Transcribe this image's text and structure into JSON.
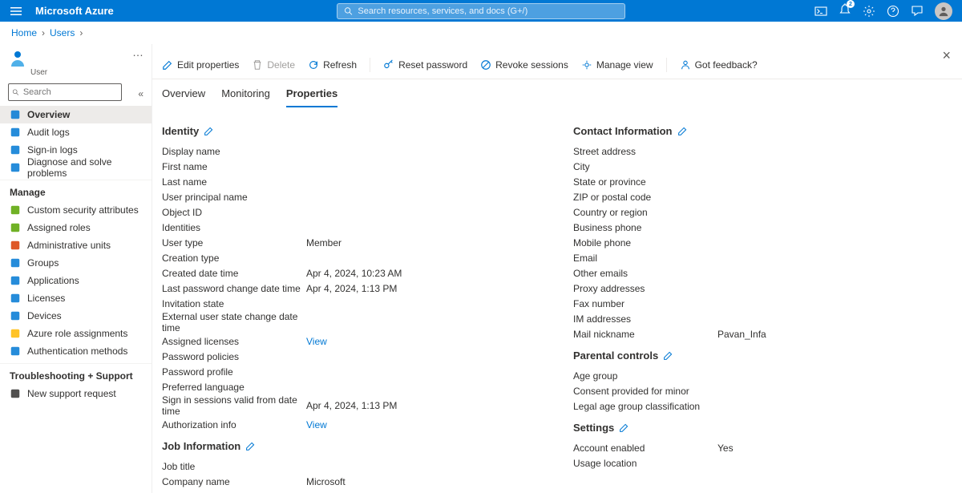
{
  "brand": "Microsoft Azure",
  "search_placeholder": "Search resources, services, and docs (G+/)",
  "notification_count": "2",
  "breadcrumb": {
    "home": "Home",
    "users": "Users"
  },
  "user_sub": "User",
  "local_search_placeholder": "Search",
  "sidebar": {
    "main": [
      {
        "label": "Overview",
        "icon": "preview"
      },
      {
        "label": "Audit logs",
        "icon": "log"
      },
      {
        "label": "Sign-in logs",
        "icon": "signin"
      },
      {
        "label": "Diagnose and solve problems",
        "icon": "diagnose"
      }
    ],
    "manage_header": "Manage",
    "manage": [
      {
        "label": "Custom security attributes",
        "icon": "sec"
      },
      {
        "label": "Assigned roles",
        "icon": "roles"
      },
      {
        "label": "Administrative units",
        "icon": "admin"
      },
      {
        "label": "Groups",
        "icon": "groups"
      },
      {
        "label": "Applications",
        "icon": "apps"
      },
      {
        "label": "Licenses",
        "icon": "lic"
      },
      {
        "label": "Devices",
        "icon": "dev"
      },
      {
        "label": "Azure role assignments",
        "icon": "key"
      },
      {
        "label": "Authentication methods",
        "icon": "auth"
      }
    ],
    "trouble_header": "Troubleshooting + Support",
    "trouble": [
      {
        "label": "New support request",
        "icon": "support"
      }
    ]
  },
  "toolbar": {
    "edit": "Edit properties",
    "delete": "Delete",
    "refresh": "Refresh",
    "reset": "Reset password",
    "revoke": "Revoke sessions",
    "manage": "Manage view",
    "feedback": "Got feedback?"
  },
  "tabs": {
    "overview": "Overview",
    "monitoring": "Monitoring",
    "properties": "Properties"
  },
  "sections": {
    "identity": "Identity",
    "job": "Job Information",
    "contact": "Contact Information",
    "parental": "Parental controls",
    "settings": "Settings"
  },
  "identity_fields": [
    {
      "label": "Display name",
      "value": ""
    },
    {
      "label": "First name",
      "value": ""
    },
    {
      "label": "Last name",
      "value": ""
    },
    {
      "label": "User principal name",
      "value": ""
    },
    {
      "label": "Object ID",
      "value": ""
    },
    {
      "label": "Identities",
      "value": ""
    },
    {
      "label": "User type",
      "value": "Member"
    },
    {
      "label": "Creation type",
      "value": ""
    },
    {
      "label": "Created date time",
      "value": "Apr 4, 2024, 10:23 AM"
    },
    {
      "label": "Last password change date time",
      "value": "Apr 4, 2024, 1:13 PM"
    },
    {
      "label": "Invitation state",
      "value": ""
    },
    {
      "label": "External user state change date time",
      "value": ""
    },
    {
      "label": "Assigned licenses",
      "value": "View",
      "link": true
    },
    {
      "label": "Password policies",
      "value": ""
    },
    {
      "label": "Password profile",
      "value": ""
    },
    {
      "label": "Preferred language",
      "value": ""
    },
    {
      "label": "Sign in sessions valid from date time",
      "value": "Apr 4, 2024, 1:13 PM"
    },
    {
      "label": "Authorization info",
      "value": "View",
      "link": true
    }
  ],
  "job_fields": [
    {
      "label": "Job title",
      "value": ""
    },
    {
      "label": "Company name",
      "value": "Microsoft"
    }
  ],
  "contact_fields": [
    {
      "label": "Street address",
      "value": ""
    },
    {
      "label": "City",
      "value": ""
    },
    {
      "label": "State or province",
      "value": ""
    },
    {
      "label": "ZIP or postal code",
      "value": ""
    },
    {
      "label": "Country or region",
      "value": ""
    },
    {
      "label": "Business phone",
      "value": ""
    },
    {
      "label": "Mobile phone",
      "value": ""
    },
    {
      "label": "Email",
      "value": ""
    },
    {
      "label": "Other emails",
      "value": ""
    },
    {
      "label": "Proxy addresses",
      "value": ""
    },
    {
      "label": "Fax number",
      "value": ""
    },
    {
      "label": "IM addresses",
      "value": ""
    },
    {
      "label": "Mail nickname",
      "value": "Pavan_Infa"
    }
  ],
  "parental_fields": [
    {
      "label": "Age group",
      "value": ""
    },
    {
      "label": "Consent provided for minor",
      "value": ""
    },
    {
      "label": "Legal age group classification",
      "value": ""
    }
  ],
  "settings_fields": [
    {
      "label": "Account enabled",
      "value": "Yes"
    },
    {
      "label": "Usage location",
      "value": ""
    }
  ]
}
